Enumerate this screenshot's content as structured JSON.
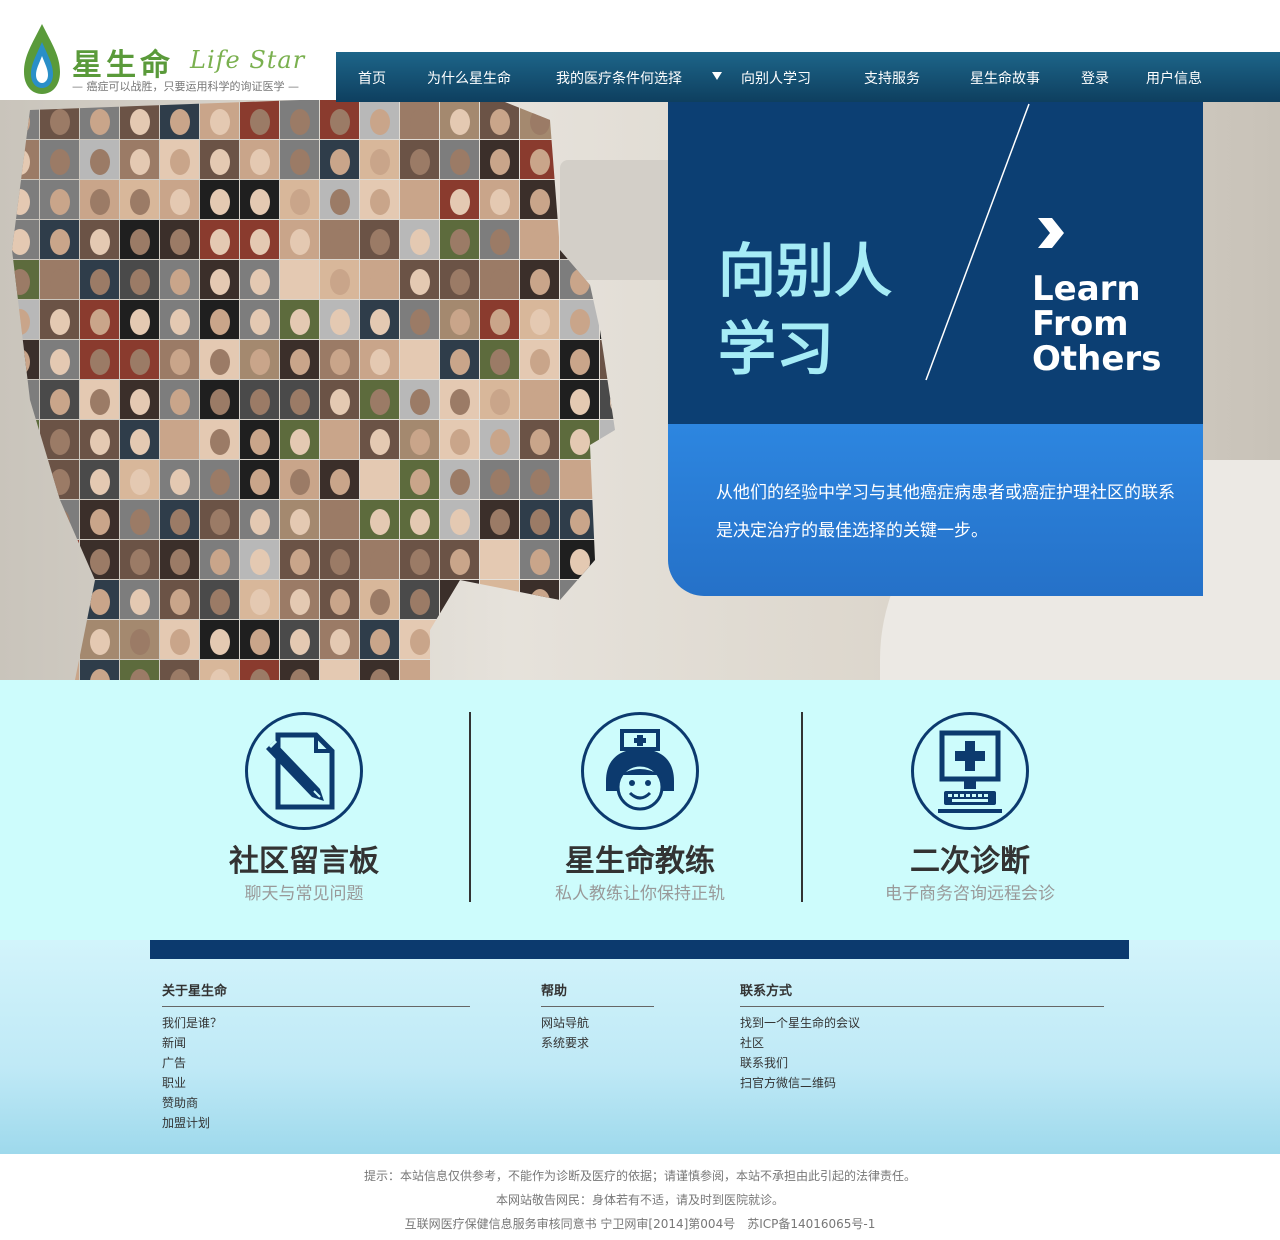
{
  "brand": {
    "name_cn": "星生命",
    "name_en": "Life Star",
    "slogan": "— 癌症可以战胜，只要运用科学的询证医学 —",
    "green": "#5a9a3a",
    "blue_drop": "#2a8fc8"
  },
  "nav": {
    "items": [
      {
        "label": "首页"
      },
      {
        "label": "为什么星生命"
      },
      {
        "label": "我的医疗条件何选择"
      },
      {
        "label": "向别人学习"
      },
      {
        "label": "支持服务"
      },
      {
        "label": "星生命故事"
      },
      {
        "label": "登录"
      },
      {
        "label": "用户信息"
      }
    ],
    "dropdown_icon": "caret-down-icon",
    "bar_color": "#15557a"
  },
  "hero": {
    "title_cn": "向别人学习",
    "title_en": [
      "Learn",
      "From",
      "Others"
    ],
    "arrow_icon": "chevron-right-icon",
    "description": "从他们的经验中学习与其他癌症病患者或癌症护理社区的联系是决定治疗的最佳选择的关键一步。",
    "card_dark": "#0c3f73",
    "card_light": "#2a7dd6",
    "title_color": "#a6ecf6"
  },
  "features": [
    {
      "icon": "pen-document-icon",
      "title": "社区留言板",
      "subtitle": "聊天与常见问题"
    },
    {
      "icon": "nurse-face-icon",
      "title": "星生命教练",
      "subtitle": "私人教练让你保持正轨"
    },
    {
      "icon": "computer-medical-icon",
      "title": "二次诊断",
      "subtitle": "电子商务咨询远程会诊"
    }
  ],
  "footer": {
    "columns": [
      {
        "heading": "关于星生命",
        "links": [
          "我们是谁？",
          "新闻",
          "广告",
          "职业",
          "赞助商",
          "加盟计划"
        ]
      },
      {
        "heading": "帮助",
        "links": [
          "网站导航",
          "系统要求"
        ]
      },
      {
        "heading": "联系方式",
        "links": [
          "找到一个星生命的会议",
          "社区",
          "联系我们",
          "扫官方微信二维码"
        ]
      }
    ],
    "bar_color": "#0c3a6e"
  },
  "notice": {
    "line1": "提示：本站信息仅供参考，不能作为诊断及医疗的依据；请谨慎参阅，本站不承担由此引起的法律责任。",
    "line2": "本网站敬告网民：身体若有不适，请及时到医院就诊。",
    "line3": "互联网医疗保健信息服务审核同意书 宁卫网审[2014]第004号　苏ICP备14016065号-1"
  }
}
